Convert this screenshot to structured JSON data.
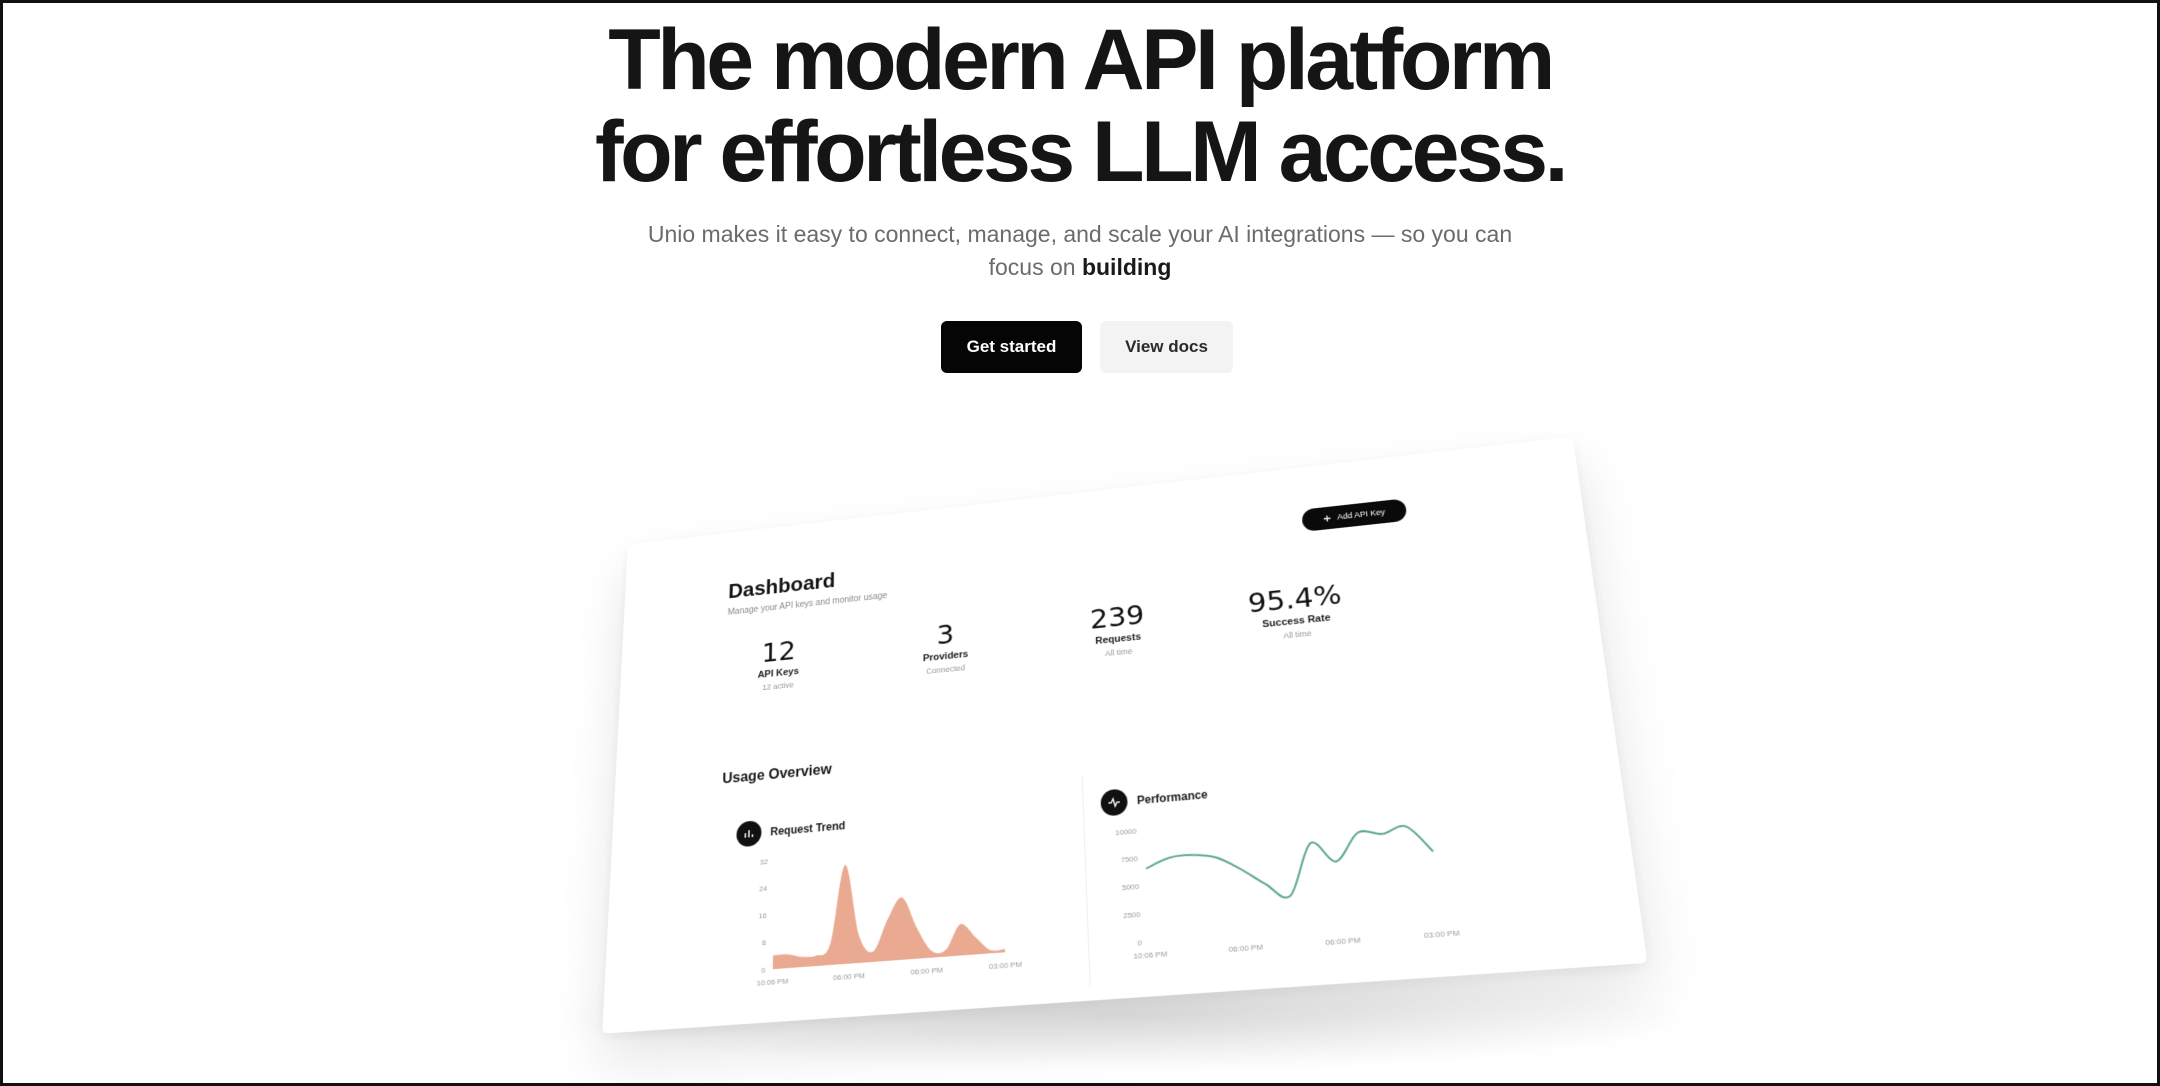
{
  "hero": {
    "headline_line1": "The modern API platform",
    "headline_line2": "for effortless LLM access.",
    "subtitle_main": "Unio makes it easy to connect, manage, and scale your AI integrations — so you can focus on",
    "subtitle_emphasis": "building",
    "primary_button": "Get started",
    "secondary_button": "View docs"
  },
  "dashboard": {
    "title": "Dashboard",
    "subtitle": "Manage your API keys and monitor usage",
    "add_button": "Add API Key",
    "add_icon": "plus-icon",
    "stats": [
      {
        "value": "12",
        "label": "API Keys",
        "sub": "12 active"
      },
      {
        "value": "3",
        "label": "Providers",
        "sub": "Connected"
      },
      {
        "value": "239",
        "label": "Requests",
        "sub": "All time"
      },
      {
        "value": "95.4%",
        "label": "Success Rate",
        "sub": "All time"
      }
    ],
    "usage_title": "Usage Overview",
    "request_trend": {
      "title": "Request Trend",
      "icon": "bar-chart-icon",
      "accent": "#e8a58b",
      "y_ticks": [
        "32",
        "24",
        "16",
        "8",
        "0"
      ],
      "x_ticks": [
        "10:06 PM",
        "06:00 PM",
        "06:00 PM",
        "03:00 PM"
      ]
    },
    "performance": {
      "title": "Performance",
      "icon": "activity-icon",
      "accent": "#5fa98a",
      "y_ticks": [
        "10000",
        "7500",
        "5000",
        "2500",
        "0"
      ],
      "x_ticks": [
        "10:06 PM",
        "06:00 PM",
        "06:00 PM",
        "03:00 PM"
      ]
    }
  },
  "chart_data": [
    {
      "type": "area",
      "title": "Request Trend",
      "x": [
        0,
        1,
        2,
        3,
        4,
        5,
        6,
        7,
        8,
        9,
        10,
        11,
        12,
        13,
        14,
        15,
        16
      ],
      "values": [
        4,
        4,
        3,
        3,
        6,
        29,
        8,
        3,
        12,
        18,
        9,
        2,
        2,
        9,
        5,
        1,
        1
      ],
      "ylim": [
        0,
        32
      ],
      "grid": false
    },
    {
      "type": "line",
      "title": "Performance",
      "x": [
        0,
        1,
        2,
        3,
        4,
        5,
        6,
        7,
        8,
        9,
        10,
        11,
        12
      ],
      "values": [
        6500,
        7300,
        7400,
        7000,
        5800,
        4300,
        3100,
        7600,
        5800,
        8200,
        7900,
        8400,
        6000
      ],
      "ylim": [
        0,
        10000
      ],
      "grid": false
    }
  ]
}
